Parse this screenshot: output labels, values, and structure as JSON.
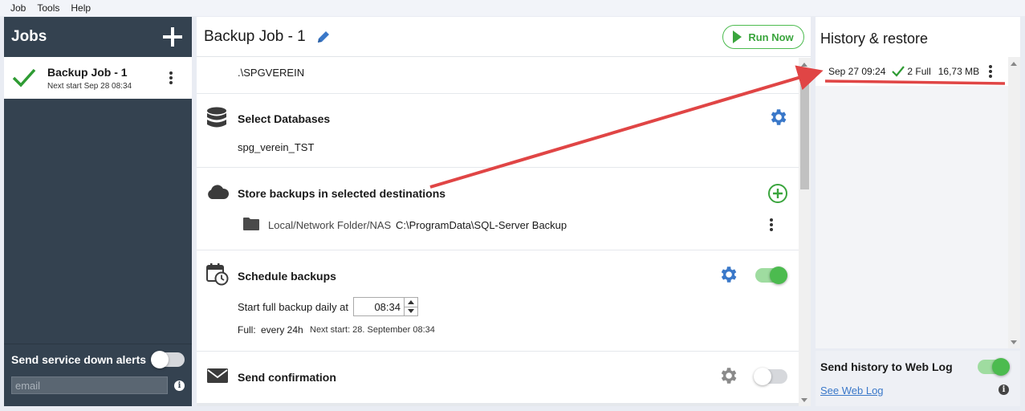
{
  "menu": [
    "Job",
    "Tools",
    "Help"
  ],
  "jobs": {
    "title": "Jobs",
    "items": [
      {
        "name": "Backup Job - 1",
        "next_start": "Next start Sep 28 08:34"
      }
    ],
    "alerts_label": "Send service down alerts",
    "alerts_enabled": false,
    "email_placeholder": "email"
  },
  "job_detail": {
    "title": "Backup Job - 1",
    "run_label": "Run Now",
    "server": ".\\SPGVEREIN",
    "databases": {
      "title": "Select Databases",
      "value": "spg_verein_TST"
    },
    "destinations": {
      "title": "Store backups in selected destinations",
      "type": "Local/Network Folder/NAS",
      "path": "C:\\ProgramData\\SQL-Server Backup"
    },
    "schedule": {
      "title": "Schedule backups",
      "enabled": true,
      "start_label": "Start full backup daily at",
      "time": "08:34",
      "full_label": "Full:",
      "full_value": "every 24h",
      "next_start": "Next start: 28. September 08:34"
    },
    "confirmation": {
      "title": "Send confirmation",
      "enabled": false
    }
  },
  "history": {
    "title": "History & restore",
    "rows": [
      {
        "date": "Sep 27 09:24",
        "result": "2 Full",
        "size": "16,73 MB"
      }
    ],
    "weblog_label": "Send history to Web Log",
    "weblog_enabled": true,
    "weblog_link": "See Web Log"
  },
  "colors": {
    "sidebar": "#344250",
    "accent_green": "#4cbb4f",
    "gear_blue": "#3a78c9",
    "annotation_red": "#e04545"
  }
}
